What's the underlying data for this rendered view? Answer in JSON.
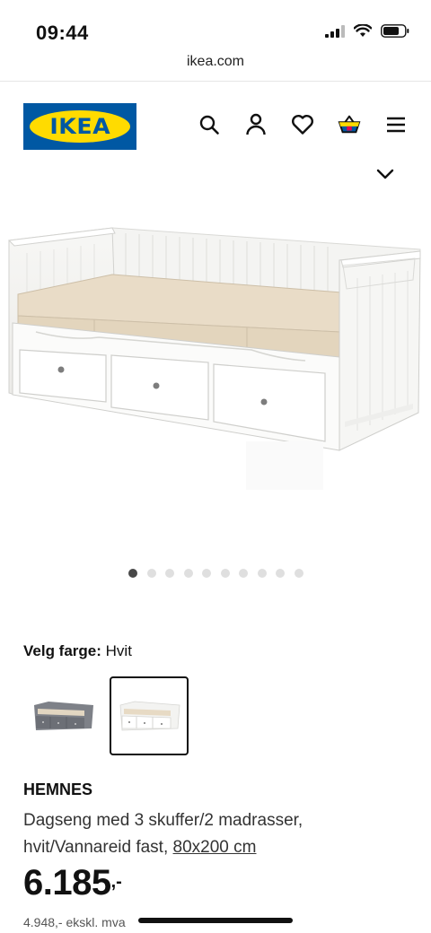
{
  "status": {
    "time": "09:44"
  },
  "browser": {
    "url": "ikea.com"
  },
  "header": {
    "logo_text": "IKEA",
    "icons": [
      "search-icon",
      "profile-icon",
      "heart-icon",
      "basket-icon",
      "menu-icon"
    ]
  },
  "colors": {
    "brand_blue": "#0058a3",
    "brand_yellow": "#ffdb00"
  },
  "gallery": {
    "image_count": 10,
    "active_index": 0
  },
  "color_picker": {
    "label": "Velg farge:",
    "selected_value": "Hvit",
    "options": [
      "Grå",
      "Hvit"
    ],
    "selected_index": 1
  },
  "product": {
    "name": "HEMNES",
    "description_line": "Dagseng med 3 skuffer/2 madrasser, hvit/Vannareid fast,",
    "size_link": "80x200 cm",
    "price": "6.185",
    "price_suffix": ",-",
    "price_ex_vat": "4.948,- ekskl. mva"
  }
}
